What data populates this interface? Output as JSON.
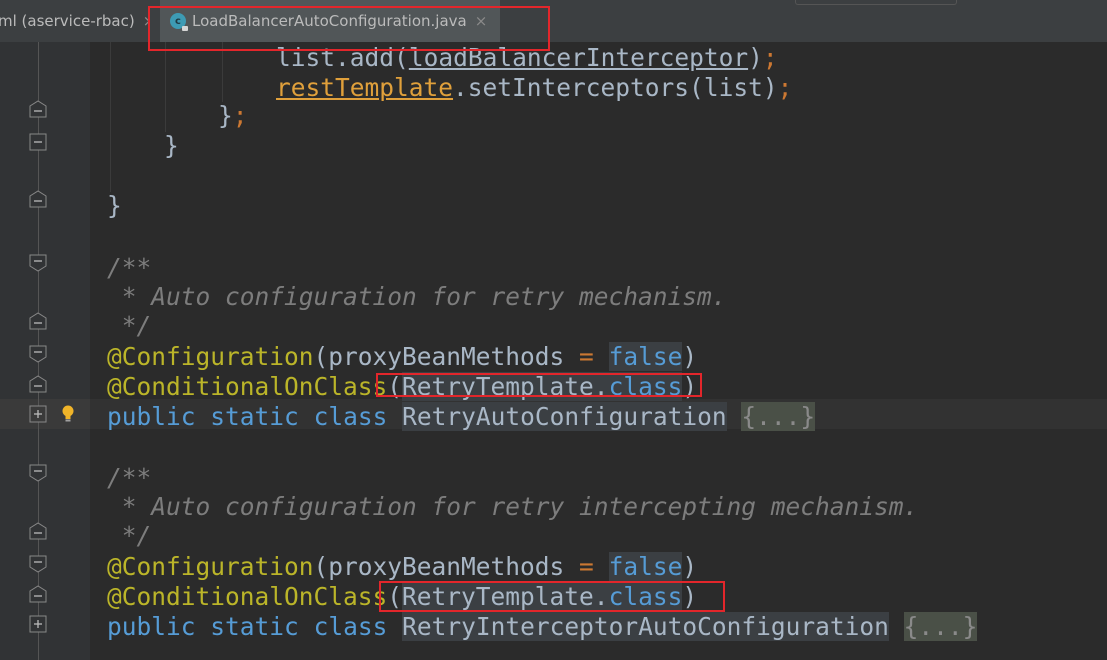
{
  "tabs": {
    "previous": {
      "label": "ml (aservice-rbac)",
      "close": "×"
    },
    "active": {
      "label": "LoadBalancerAutoConfiguration.java",
      "close": "×",
      "icon": "java-class-icon"
    }
  },
  "code": {
    "l1": {
      "a": "list",
      "b": ".",
      "c": "add",
      "d": "(",
      "e": "loadBalancerInterceptor",
      "f": ")",
      "g": ";"
    },
    "l2": {
      "a": "restTemplate",
      "b": ".",
      "c": "setInterceptors",
      "d": "(",
      "e": "list",
      "f": ")",
      "g": ";"
    },
    "l3": {
      "a": "}",
      "b": ";"
    },
    "l4": {
      "a": "}"
    },
    "l5": {
      "a": "}"
    },
    "l6": {
      "a": "/**"
    },
    "l7": {
      "a": " * Auto configuration for retry mechanism."
    },
    "l8": {
      "a": " */"
    },
    "l9": {
      "a": "@Configuration",
      "b": "(proxyBeanMethods ",
      "c": "=",
      "d": " ",
      "e": "false",
      "f": ")"
    },
    "l10": {
      "a": "@ConditionalOnClass",
      "b": "(",
      "c": "RetryTemplate",
      "d": ".",
      "e": "class",
      "f": ")"
    },
    "l11": {
      "a": "public",
      "b": " ",
      "c": "static",
      "d": " ",
      "e": "class",
      "f": " ",
      "g": "RetryAutoConfiguration",
      "h": " ",
      "i": "{...}"
    },
    "l12": {
      "a": "/**"
    },
    "l13": {
      "a": " * Auto configuration for retry intercepting mechanism."
    },
    "l14": {
      "a": " */"
    },
    "l15": {
      "a": "@Configuration",
      "b": "(proxyBeanMethods ",
      "c": "=",
      "d": " ",
      "e": "false",
      "f": ")"
    },
    "l16": {
      "a": "@ConditionalOnClass",
      "b": "(",
      "c": "RetryTemplate",
      "d": ".",
      "e": "class",
      "f": ")"
    },
    "l17": {
      "a": "public",
      "b": " ",
      "c": "static",
      "d": " ",
      "e": "class",
      "f": " ",
      "g": "RetryInterceptorAutoConfiguration",
      "h": " ",
      "i": "{...}"
    }
  },
  "colors": {
    "highlight_box": "#e3262b",
    "keyword": "#569cd6",
    "annotation": "#bbb529",
    "field": "#e0a03b",
    "comment": "#7d7d7d",
    "background": "#2b2b2b"
  }
}
